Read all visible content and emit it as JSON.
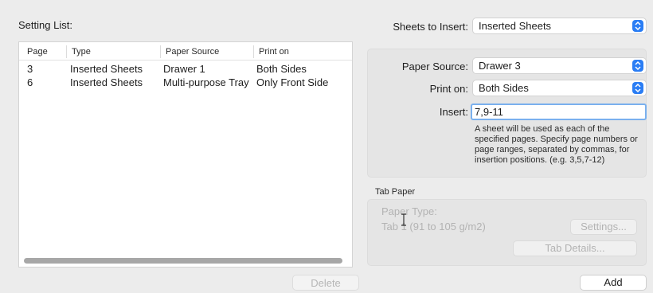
{
  "left_panel": {
    "setting_list_label": "Setting List:",
    "columns": [
      "Page",
      "Type",
      "Paper Source",
      "Print on"
    ],
    "rows": [
      [
        "3",
        "Inserted Sheets",
        "Drawer 1",
        "Both Sides"
      ],
      [
        "6",
        "Inserted Sheets",
        "Multi-purpose Tray",
        "Only Front Side"
      ]
    ],
    "delete_label": "Delete"
  },
  "right_panel": {
    "sheets_to_insert_label": "Sheets to Insert:",
    "sheets_to_insert_value": "Inserted Sheets",
    "paper_source_label": "Paper Source:",
    "paper_source_value": "Drawer 3",
    "print_on_label": "Print on:",
    "print_on_value": "Both Sides",
    "insert_label": "Insert:",
    "insert_value": "7,9-11",
    "help_text": "A sheet will be used as each of the specified pages. Specify page numbers or page ranges, separated by commas, for insertion positions. (e.g. 3,5,7-12)",
    "tab_paper": {
      "label": "Tab Paper",
      "paper_type_label": "Paper Type:",
      "paper_type_value": "Tab 1 (91 to 105 g/m2)",
      "settings_label": "Settings...",
      "tab_details_label": "Tab Details..."
    },
    "add_label": "Add"
  },
  "colors": {
    "window_bg": "#ececec",
    "accent": "#2a7df4",
    "focus_ring": "#7ab0ee",
    "disabled_text": "#b3b3b3"
  },
  "icons": {
    "select_arrows": "up-down-chevron-icon",
    "text_cursor": "i-beam-cursor-icon"
  }
}
